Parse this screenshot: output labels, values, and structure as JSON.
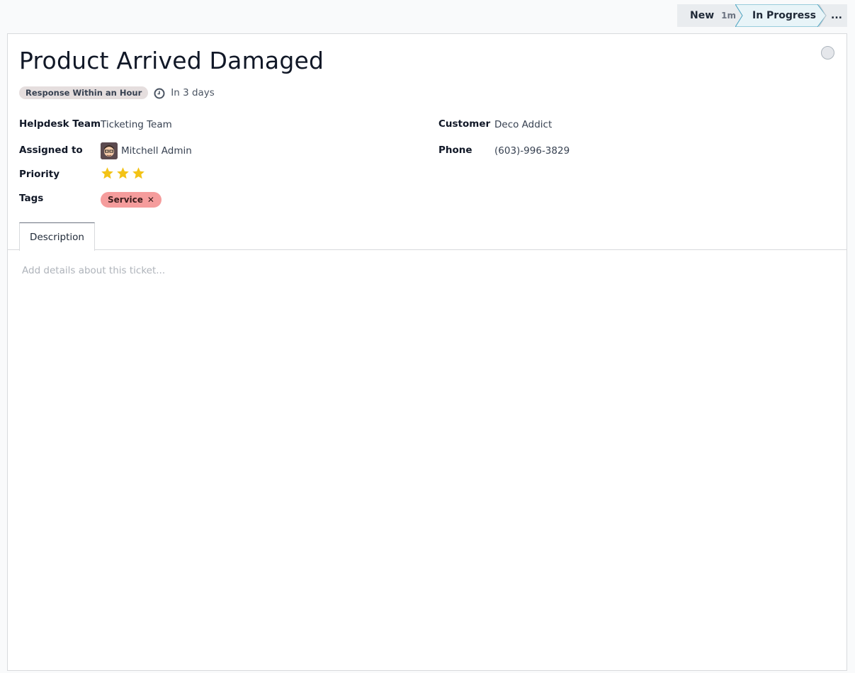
{
  "status_bar": {
    "stages": [
      {
        "label": "New",
        "duration": "1m",
        "active": false
      },
      {
        "label": "In Progress",
        "active": true
      }
    ],
    "more_label": "..."
  },
  "ticket": {
    "title": "Product Arrived Damaged",
    "sla_badge": "Response Within an Hour",
    "deadline": "In 3 days"
  },
  "fields": {
    "helpdesk_team": {
      "label": "Helpdesk Team",
      "value": "Ticketing Team"
    },
    "assigned_to": {
      "label": "Assigned to",
      "value": "Mitchell Admin"
    },
    "priority": {
      "label": "Priority",
      "stars_filled": 3,
      "stars_total": 3
    },
    "tags": {
      "label": "Tags",
      "items": [
        "Service"
      ]
    },
    "customer": {
      "label": "Customer",
      "value": "Deco Addict"
    },
    "phone": {
      "label": "Phone",
      "value": "(603)-996-3829"
    }
  },
  "tabs": [
    {
      "label": "Description",
      "active": true
    }
  ],
  "description": {
    "placeholder": "Add details about this ticket..."
  },
  "colors": {
    "star": "#f3c316",
    "tag_bg": "#f59c9c",
    "active_stage_bg": "#e8f4f8",
    "active_stage_border": "#4aa3c0"
  },
  "icons": {
    "kanban_state": "circle-icon",
    "deadline": "clock-icon",
    "avatar": "user-avatar",
    "tag_remove": "close-icon"
  }
}
